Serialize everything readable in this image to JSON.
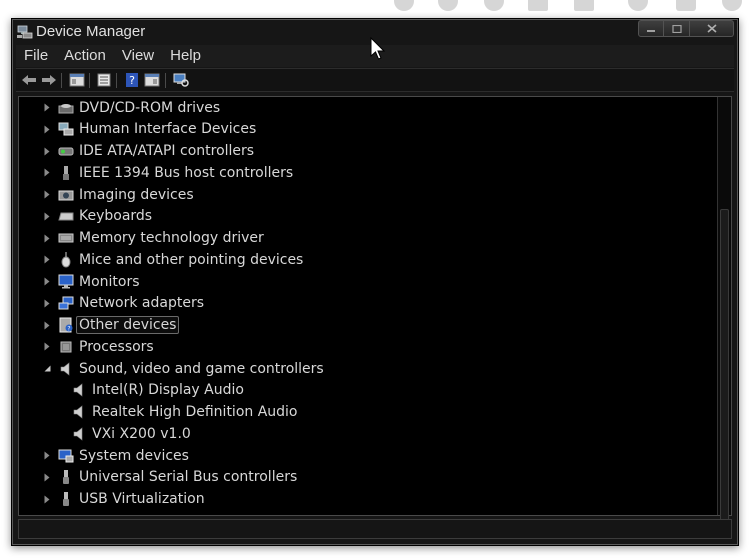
{
  "window": {
    "title": "Device Manager",
    "controls": {
      "minimize": "minimize",
      "maximize": "maximize",
      "close": "close"
    }
  },
  "menu": [
    {
      "label": "File"
    },
    {
      "label": "Action"
    },
    {
      "label": "View"
    },
    {
      "label": "Help"
    }
  ],
  "toolbar": [
    {
      "icon": "back-arrow-icon"
    },
    {
      "icon": "forward-arrow-icon"
    },
    {
      "icon": "show-hide-console-tree-icon"
    },
    {
      "icon": "properties-icon"
    },
    {
      "icon": "help-icon"
    },
    {
      "icon": "show-hide-action-pane-icon"
    },
    {
      "icon": "scan-hardware-icon"
    }
  ],
  "tree": [
    {
      "label": "DVD/CD-ROM drives",
      "icon": "dvd-drive-icon",
      "level": 0,
      "expanded": false
    },
    {
      "label": "Human Interface Devices",
      "icon": "hid-icon",
      "level": 0,
      "expanded": false
    },
    {
      "label": "IDE ATA/ATAPI controllers",
      "icon": "ide-controller-icon",
      "level": 0,
      "expanded": false
    },
    {
      "label": "IEEE 1394 Bus host controllers",
      "icon": "ieee1394-icon",
      "level": 0,
      "expanded": false
    },
    {
      "label": "Imaging devices",
      "icon": "imaging-device-icon",
      "level": 0,
      "expanded": false
    },
    {
      "label": "Keyboards",
      "icon": "keyboard-icon",
      "level": 0,
      "expanded": false
    },
    {
      "label": "Memory technology driver",
      "icon": "memory-driver-icon",
      "level": 0,
      "expanded": false
    },
    {
      "label": "Mice and other pointing devices",
      "icon": "mouse-icon",
      "level": 0,
      "expanded": false
    },
    {
      "label": "Monitors",
      "icon": "monitor-icon",
      "level": 0,
      "expanded": false
    },
    {
      "label": "Network adapters",
      "icon": "network-adapter-icon",
      "level": 0,
      "expanded": false
    },
    {
      "label": "Other devices",
      "icon": "other-devices-icon",
      "level": 0,
      "expanded": false,
      "selected": true
    },
    {
      "label": "Processors",
      "icon": "processor-icon",
      "level": 0,
      "expanded": false
    },
    {
      "label": "Sound, video and game controllers",
      "icon": "speaker-icon",
      "level": 0,
      "expanded": true
    },
    {
      "label": "Intel(R) Display Audio",
      "icon": "speaker-icon",
      "level": 1
    },
    {
      "label": "Realtek High Definition Audio",
      "icon": "speaker-icon",
      "level": 1
    },
    {
      "label": "VXi X200 v1.0",
      "icon": "speaker-icon",
      "level": 1
    },
    {
      "label": "System devices",
      "icon": "system-device-icon",
      "level": 0,
      "expanded": false
    },
    {
      "label": "Universal Serial Bus controllers",
      "icon": "usb-icon",
      "level": 0,
      "expanded": false
    },
    {
      "label": "USB Virtualization",
      "icon": "usb-icon",
      "level": 0,
      "expanded": false
    }
  ],
  "colors": {
    "window_bg": "#161616",
    "tree_bg": "#000000",
    "text": "#d8d8d8",
    "selection_border": "#6a6a6a"
  }
}
